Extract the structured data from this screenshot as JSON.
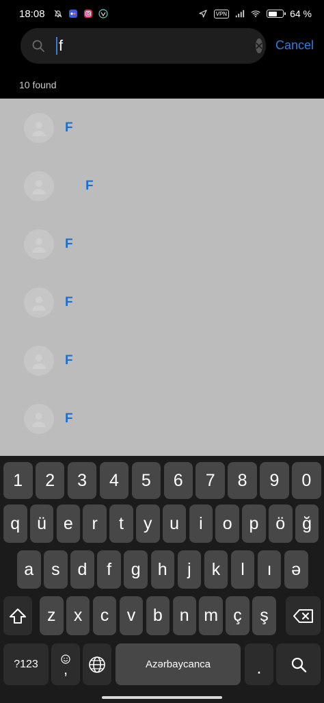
{
  "status_bar": {
    "time": "18:08",
    "vpn_label": "VPN",
    "battery_percent_text": "64 %",
    "battery_level": 0.64
  },
  "search": {
    "query": "f",
    "cancel_label": "Cancel"
  },
  "results": {
    "found_text": "10 found",
    "items": [
      {
        "name": "F"
      },
      {
        "name": "F"
      },
      {
        "name": "F"
      },
      {
        "name": "F"
      },
      {
        "name": "F"
      },
      {
        "name": "F"
      }
    ]
  },
  "keyboard": {
    "row_numbers": [
      "1",
      "2",
      "3",
      "4",
      "5",
      "6",
      "7",
      "8",
      "9",
      "0"
    ],
    "row_top": [
      "q",
      "ü",
      "e",
      "r",
      "t",
      "y",
      "u",
      "i",
      "o",
      "p",
      "ö",
      "ğ"
    ],
    "row_mid": [
      "a",
      "s",
      "d",
      "f",
      "g",
      "h",
      "j",
      "k",
      "l",
      "ı",
      "ə"
    ],
    "row_bottom": [
      "z",
      "x",
      "c",
      "v",
      "b",
      "n",
      "m",
      "ç",
      "ş"
    ],
    "symbols_label": "?123",
    "comma_label": ",",
    "space_label": "Azərbaycanca",
    "period_label": "."
  },
  "colors": {
    "accent": "#2a7ee6",
    "contact_name": "#1a6fcf"
  }
}
